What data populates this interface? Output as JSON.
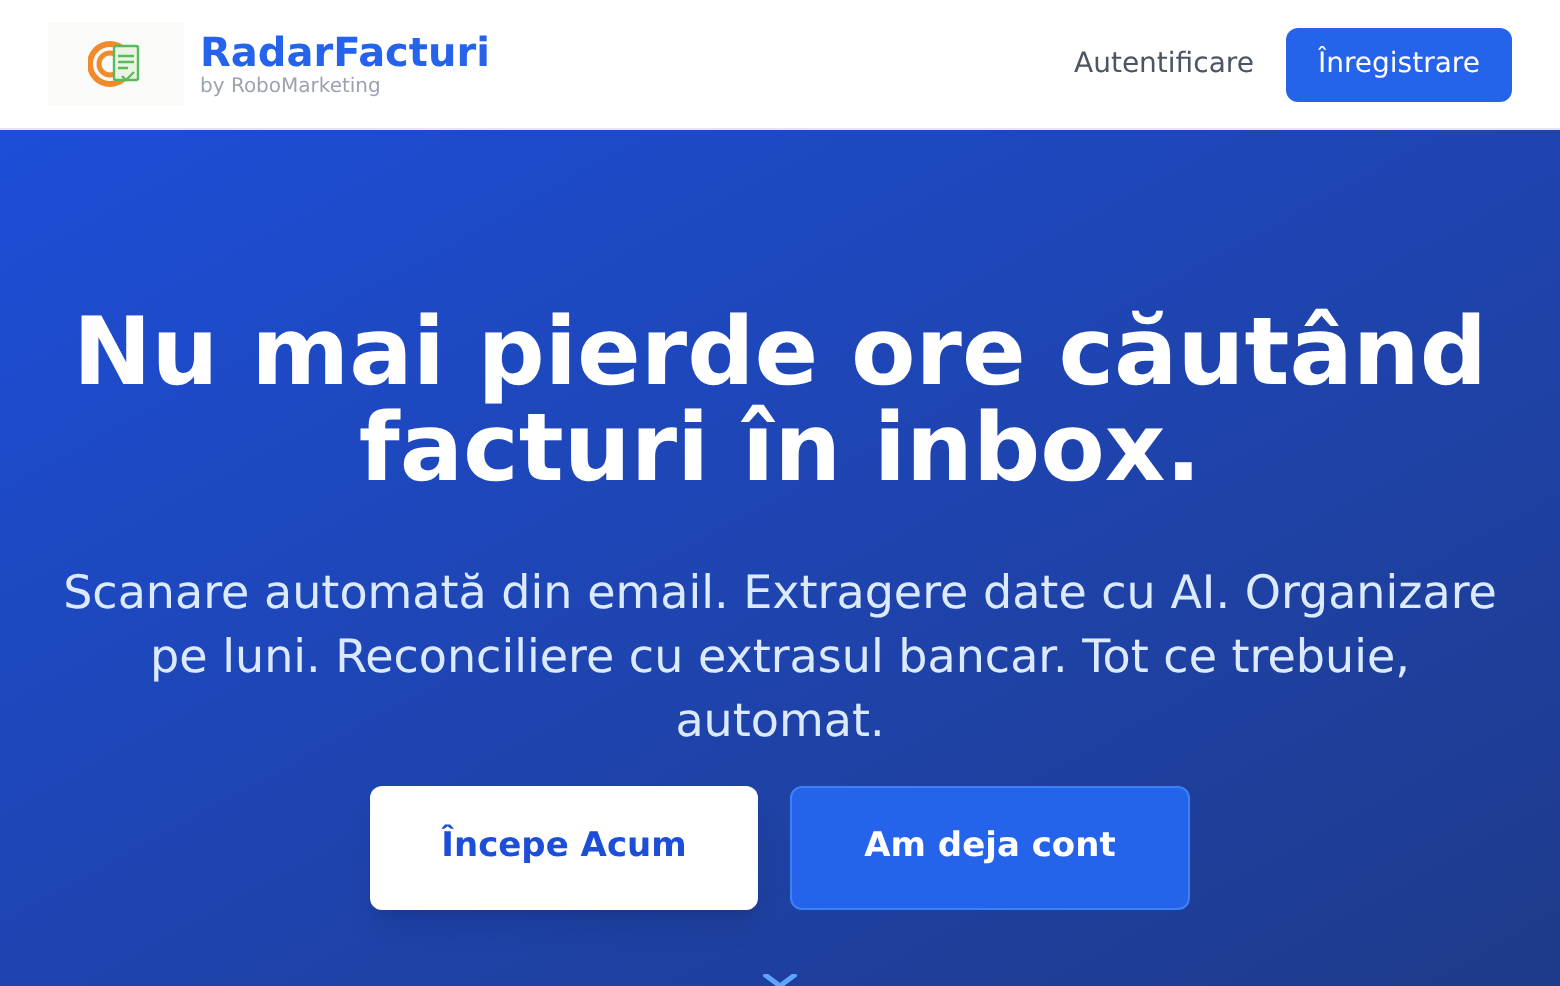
{
  "brand": {
    "name": "RadarFacturi",
    "tagline": "by RoboMarketing"
  },
  "nav": [
    {
      "label": "Autentificare",
      "kind": "link"
    },
    {
      "label": "Înregistrare",
      "kind": "primary"
    }
  ],
  "hero": {
    "title": "Nu mai pierde ore căutând facturi în inbox.",
    "subtitle": "Scanare automată din email. Extragere date cu AI. Organizare pe luni. Reconciliere cu extrasul bancar. Tot ce trebuie, automat.",
    "buttons": [
      {
        "label": "Începe Acum",
        "kind": "light"
      },
      {
        "label": "Am deja cont",
        "kind": "solid"
      }
    ]
  }
}
